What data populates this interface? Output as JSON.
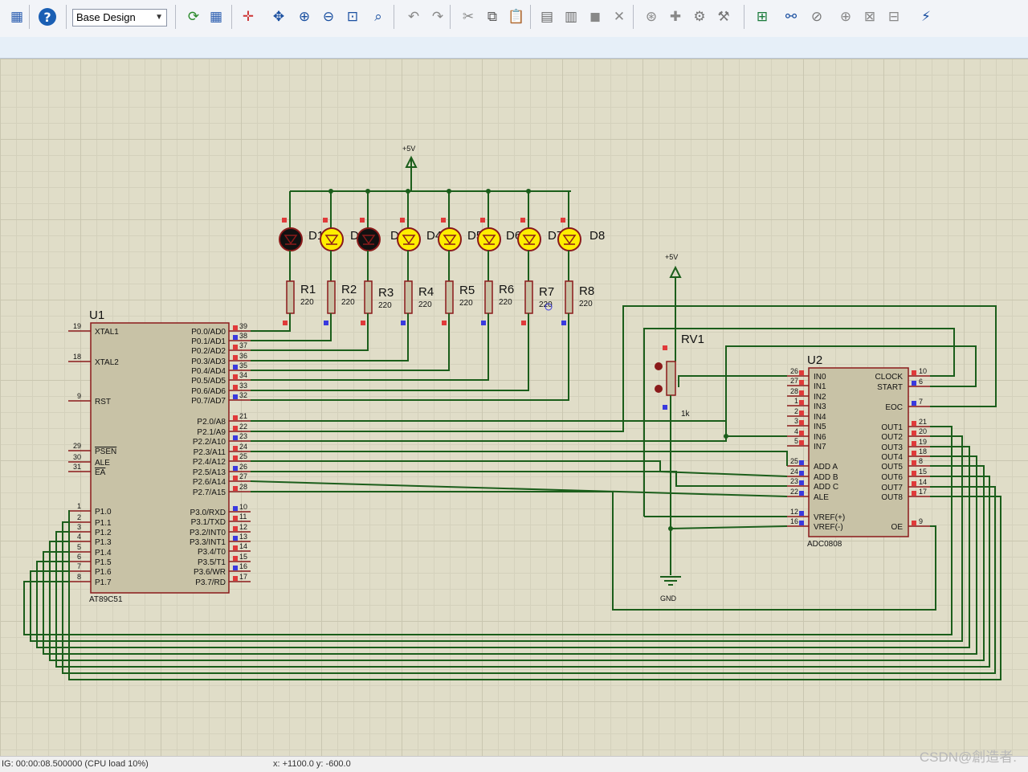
{
  "toolbar": {
    "layer_select": "Base Design",
    "icons": [
      "component-mode-icon",
      "report-icon",
      "help-icon",
      "refresh-icon",
      "grid-icon",
      "origin-icon",
      "pan-icon",
      "zoom-in-icon",
      "zoom-out-icon",
      "zoom-all-icon",
      "zoom-area-icon",
      "undo-icon",
      "redo-icon",
      "cut-icon",
      "copy-icon",
      "paste-icon",
      "block-copy-icon",
      "block-move-icon",
      "block-rotate-icon",
      "block-delete-icon",
      "pick-device-icon",
      "make-device-icon",
      "packaging-tool-icon",
      "decompose-icon",
      "wire-autorouter-icon",
      "search-tag-icon",
      "property-assignment-icon",
      "new-sheet-icon",
      "remove-sheet-icon",
      "goto-sheet-icon",
      "bill-of-materials-icon"
    ]
  },
  "colors": {
    "wire": "#1b5e1b",
    "body": "#c8c2a6",
    "body_outline": "#8a1a1a",
    "pin": "#8a1a1a",
    "led_on": "#ffee00",
    "led_off": "#111111"
  },
  "schematic": {
    "vcc1": "+5V",
    "vcc2": "+5V",
    "gnd": "GND",
    "rv1": {
      "ref": "RV1",
      "value": "1k"
    },
    "leds": [
      "D1",
      "D2",
      "D3",
      "D4",
      "D5",
      "D6",
      "D7",
      "D8"
    ],
    "resistors": [
      {
        "ref": "R1",
        "value": "220"
      },
      {
        "ref": "R2",
        "value": "220"
      },
      {
        "ref": "R3",
        "value": "220"
      },
      {
        "ref": "R4",
        "value": "220"
      },
      {
        "ref": "R5",
        "value": "220"
      },
      {
        "ref": "R6",
        "value": "220"
      },
      {
        "ref": "R7",
        "value": "220"
      },
      {
        "ref": "R8",
        "value": "220"
      }
    ],
    "u1": {
      "ref": "U1",
      "part": "AT89C51",
      "left_pins": [
        {
          "num": "19",
          "name": "XTAL1"
        },
        {
          "num": "18",
          "name": "XTAL2"
        },
        {
          "num": "9",
          "name": "RST"
        },
        {
          "num": "29",
          "name": "PSEN"
        },
        {
          "num": "30",
          "name": "ALE"
        },
        {
          "num": "31",
          "name": "EA"
        },
        {
          "num": "1",
          "name": "P1.0"
        },
        {
          "num": "2",
          "name": "P1.1"
        },
        {
          "num": "3",
          "name": "P1.2"
        },
        {
          "num": "4",
          "name": "P1.3"
        },
        {
          "num": "5",
          "name": "P1.4"
        },
        {
          "num": "6",
          "name": "P1.5"
        },
        {
          "num": "7",
          "name": "P1.6"
        },
        {
          "num": "8",
          "name": "P1.7"
        }
      ],
      "right_pins": [
        {
          "num": "39",
          "name": "P0.0/AD0"
        },
        {
          "num": "38",
          "name": "P0.1/AD1"
        },
        {
          "num": "37",
          "name": "P0.2/AD2"
        },
        {
          "num": "36",
          "name": "P0.3/AD3"
        },
        {
          "num": "35",
          "name": "P0.4/AD4"
        },
        {
          "num": "34",
          "name": "P0.5/AD5"
        },
        {
          "num": "33",
          "name": "P0.6/AD6"
        },
        {
          "num": "32",
          "name": "P0.7/AD7"
        },
        {
          "num": "21",
          "name": "P2.0/A8"
        },
        {
          "num": "22",
          "name": "P2.1/A9"
        },
        {
          "num": "23",
          "name": "P2.2/A10"
        },
        {
          "num": "24",
          "name": "P2.3/A11"
        },
        {
          "num": "25",
          "name": "P2.4/A12"
        },
        {
          "num": "26",
          "name": "P2.5/A13"
        },
        {
          "num": "27",
          "name": "P2.6/A14"
        },
        {
          "num": "28",
          "name": "P2.7/A15"
        },
        {
          "num": "10",
          "name": "P3.0/RXD"
        },
        {
          "num": "11",
          "name": "P3.1/TXD"
        },
        {
          "num": "12",
          "name": "P3.2/INT0"
        },
        {
          "num": "13",
          "name": "P3.3/INT1"
        },
        {
          "num": "14",
          "name": "P3.4/T0"
        },
        {
          "num": "15",
          "name": "P3.5/T1"
        },
        {
          "num": "16",
          "name": "P3.6/WR"
        },
        {
          "num": "17",
          "name": "P3.7/RD"
        }
      ]
    },
    "u2": {
      "ref": "U2",
      "part": "ADC0808",
      "left_pins": [
        {
          "num": "26",
          "name": "IN0"
        },
        {
          "num": "27",
          "name": "IN1"
        },
        {
          "num": "28",
          "name": "IN2"
        },
        {
          "num": "1",
          "name": "IN3"
        },
        {
          "num": "2",
          "name": "IN4"
        },
        {
          "num": "3",
          "name": "IN5"
        },
        {
          "num": "4",
          "name": "IN6"
        },
        {
          "num": "5",
          "name": "IN7"
        },
        {
          "num": "25",
          "name": "ADD A"
        },
        {
          "num": "24",
          "name": "ADD B"
        },
        {
          "num": "23",
          "name": "ADD C"
        },
        {
          "num": "22",
          "name": "ALE"
        },
        {
          "num": "12",
          "name": "VREF(+)"
        },
        {
          "num": "16",
          "name": "VREF(-)"
        }
      ],
      "right_pins": [
        {
          "num": "10",
          "name": "CLOCK"
        },
        {
          "num": "6",
          "name": "START"
        },
        {
          "num": "7",
          "name": "EOC"
        },
        {
          "num": "21",
          "name": "OUT1"
        },
        {
          "num": "20",
          "name": "OUT2"
        },
        {
          "num": "19",
          "name": "OUT3"
        },
        {
          "num": "18",
          "name": "OUT4"
        },
        {
          "num": "8",
          "name": "OUT5"
        },
        {
          "num": "15",
          "name": "OUT6"
        },
        {
          "num": "14",
          "name": "OUT7"
        },
        {
          "num": "17",
          "name": "OUT8"
        },
        {
          "num": "9",
          "name": "OE"
        }
      ]
    }
  },
  "status": {
    "sim_time": "IG: 00:00:08.500000 (CPU load 10%)",
    "coords": "x: +1100.0   y: -600.0"
  },
  "watermark": "CSDN@創造者."
}
